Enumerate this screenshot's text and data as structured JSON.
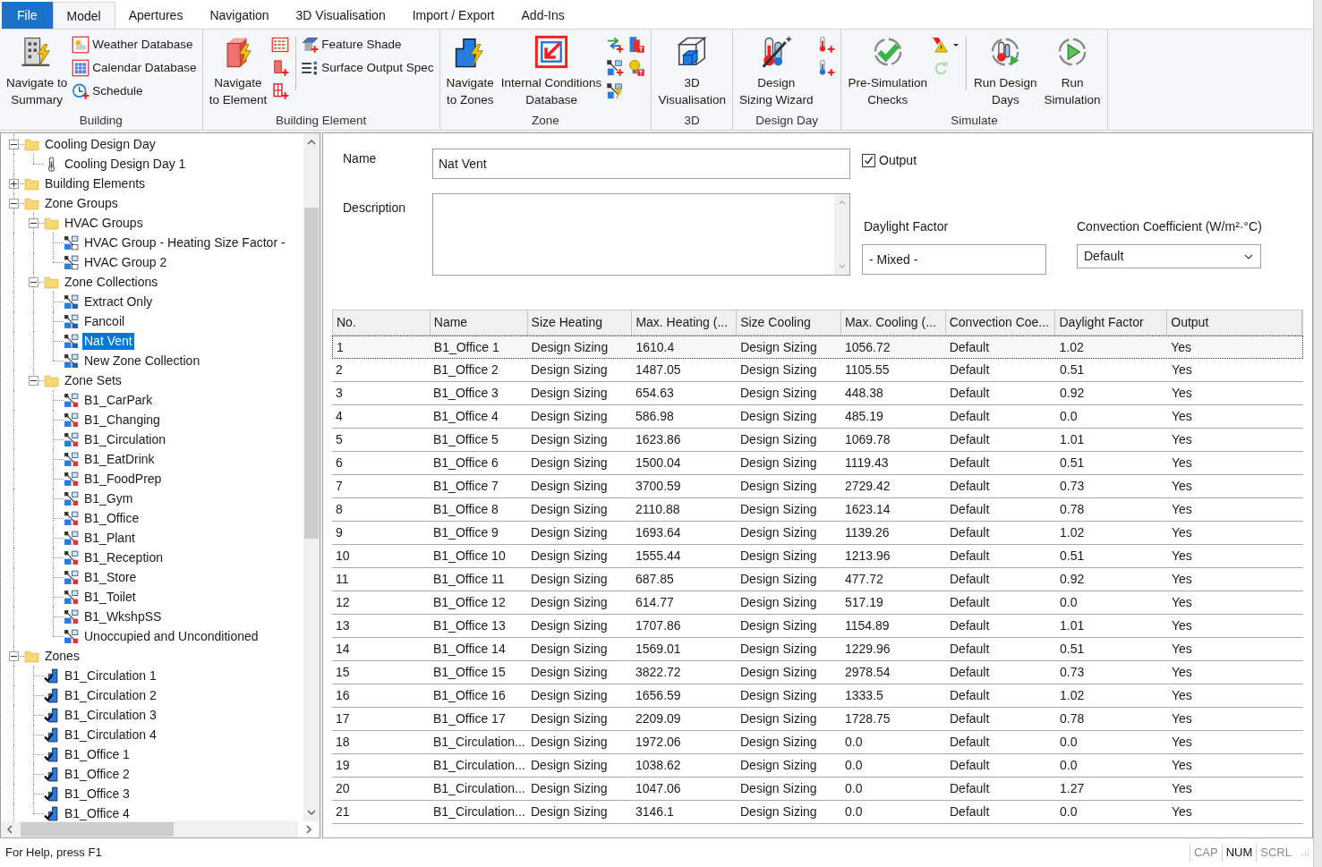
{
  "tabs": [
    {
      "label": "File",
      "kind": "file",
      "selected": false
    },
    {
      "label": "Model",
      "kind": "tab",
      "selected": true
    },
    {
      "label": "Apertures",
      "kind": "tab",
      "selected": false
    },
    {
      "label": "Navigation",
      "kind": "tab",
      "selected": false
    },
    {
      "label": "3D Visualisation",
      "kind": "tab",
      "selected": false
    },
    {
      "label": "Import / Export",
      "kind": "tab",
      "selected": false
    },
    {
      "label": "Add-Ins",
      "kind": "tab",
      "selected": false
    }
  ],
  "ribbon": {
    "groups": [
      {
        "label": "Building",
        "columns": [
          {
            "kind": "large",
            "label": "Navigate to\nSummary"
          },
          {
            "kind": "stack",
            "items": [
              {
                "kind": "small",
                "label": "Weather Database"
              },
              {
                "kind": "small",
                "label": "Calendar Database"
              },
              {
                "kind": "small",
                "label": "Schedule"
              }
            ]
          }
        ]
      },
      {
        "label": "Building Element",
        "columns": [
          {
            "kind": "large",
            "label": "Navigate\nto Element"
          },
          {
            "kind": "stack",
            "items": [
              {
                "kind": "icon"
              },
              {
                "kind": "icon"
              },
              {
                "kind": "icon"
              }
            ]
          },
          {
            "kind": "stack",
            "divider_before": true,
            "items": [
              {
                "kind": "small",
                "label": "Feature Shade"
              },
              {
                "kind": "small",
                "label": "Surface Output Spec"
              }
            ]
          }
        ]
      },
      {
        "label": "Zone",
        "columns": [
          {
            "kind": "large",
            "label": "Navigate\nto Zones"
          },
          {
            "kind": "large",
            "label": "Internal Conditions\nDatabase"
          },
          {
            "kind": "stack",
            "items": [
              {
                "kind": "icon"
              },
              {
                "kind": "icon"
              },
              {
                "kind": "icon"
              }
            ]
          },
          {
            "kind": "stack",
            "items": [
              {
                "kind": "icon"
              },
              {
                "kind": "icon"
              }
            ]
          }
        ]
      },
      {
        "label": "3D",
        "columns": [
          {
            "kind": "large",
            "label": "3D\nVisualisation"
          }
        ]
      },
      {
        "label": "Design Day",
        "columns": [
          {
            "kind": "large",
            "label": "Design\nSizing Wizard"
          },
          {
            "kind": "stack",
            "items": [
              {
                "kind": "icon"
              },
              {
                "kind": "icon"
              }
            ]
          }
        ]
      },
      {
        "label": "Simulate",
        "columns": [
          {
            "kind": "large",
            "label": "Pre-Simulation\nChecks",
            "disabled": false
          },
          {
            "kind": "stack",
            "items": [
              {
                "kind": "split",
                "disabled": false
              },
              {
                "kind": "icon",
                "disabled": true
              }
            ]
          },
          {
            "kind": "large",
            "divider_before": true,
            "label": "Run Design\nDays",
            "disabled": false
          },
          {
            "kind": "large",
            "label": "Run\nSimulation",
            "disabled": false
          }
        ]
      }
    ]
  },
  "tree": [
    {
      "label": "Cooling Design Day",
      "kind": "folder",
      "expanded": true,
      "selected": false,
      "children": [
        {
          "label": "Cooling Design Day 1",
          "kind": "design-day",
          "selected": false
        }
      ]
    },
    {
      "label": "Building Elements",
      "kind": "folder",
      "expanded": false,
      "selected": false
    },
    {
      "label": "Zone Groups",
      "kind": "folder",
      "expanded": true,
      "selected": false,
      "children": [
        {
          "label": "HVAC Groups",
          "kind": "folder",
          "expanded": true,
          "selected": false,
          "children": [
            {
              "label": "HVAC Group - Heating Size Factor -",
              "kind": "hvac",
              "selected": false
            },
            {
              "label": "HVAC Group 2",
              "kind": "hvac",
              "selected": false
            }
          ]
        },
        {
          "label": "Zone Collections",
          "kind": "folder",
          "expanded": true,
          "selected": false,
          "children": [
            {
              "label": "Extract Only",
              "kind": "collection",
              "selected": false
            },
            {
              "label": "Fancoil",
              "kind": "collection",
              "selected": false
            },
            {
              "label": "Nat Vent",
              "kind": "collection",
              "selected": true
            },
            {
              "label": "New Zone Collection",
              "kind": "collection",
              "selected": false
            }
          ]
        },
        {
          "label": "Zone Sets",
          "kind": "folder",
          "expanded": true,
          "selected": false,
          "children": [
            {
              "label": "B1_CarPark",
              "kind": "set",
              "selected": false
            },
            {
              "label": "B1_Changing",
              "kind": "set",
              "selected": false
            },
            {
              "label": "B1_Circulation",
              "kind": "set",
              "selected": false
            },
            {
              "label": "B1_EatDrink",
              "kind": "set",
              "selected": false
            },
            {
              "label": "B1_FoodPrep",
              "kind": "set",
              "selected": false
            },
            {
              "label": "B1_Gym",
              "kind": "set",
              "selected": false
            },
            {
              "label": "B1_Office",
              "kind": "set",
              "selected": false
            },
            {
              "label": "B1_Plant",
              "kind": "set",
              "selected": false
            },
            {
              "label": "B1_Reception",
              "kind": "set",
              "selected": false
            },
            {
              "label": "B1_Store",
              "kind": "set",
              "selected": false
            },
            {
              "label": "B1_Toilet",
              "kind": "set",
              "selected": false
            },
            {
              "label": "B1_WkshpSS",
              "kind": "set",
              "selected": false
            },
            {
              "label": "Unoccupied and Unconditioned",
              "kind": "set",
              "selected": false
            }
          ]
        }
      ]
    },
    {
      "label": "Zones",
      "kind": "folder",
      "expanded": true,
      "selected": false,
      "children": [
        {
          "label": "B1_Circulation 1",
          "kind": "zone",
          "selected": false
        },
        {
          "label": "B1_Circulation 2",
          "kind": "zone",
          "selected": false
        },
        {
          "label": "B1_Circulation 3",
          "kind": "zone",
          "selected": false
        },
        {
          "label": "B1_Circulation 4",
          "kind": "zone",
          "selected": false
        },
        {
          "label": "B1_Office 1",
          "kind": "zone",
          "selected": false
        },
        {
          "label": "B1_Office 2",
          "kind": "zone",
          "selected": false
        },
        {
          "label": "B1_Office 3",
          "kind": "zone",
          "selected": false
        },
        {
          "label": "B1_Office 4",
          "kind": "zone",
          "selected": false
        }
      ]
    }
  ],
  "form": {
    "name": {
      "label": "Name",
      "value": "Nat Vent"
    },
    "output": {
      "label": "Output",
      "checked": true
    },
    "description": {
      "label": "Description"
    },
    "daylight_factor": {
      "label": "Daylight Factor",
      "value": "- Mixed -"
    },
    "convection_coefficient": {
      "label": "Convection Coefficient (W/m²·°C)",
      "value": "Default"
    }
  },
  "table": {
    "columns": [
      "No.",
      "Name",
      "Size Heating",
      "Max. Heating (...",
      "Size Cooling",
      "Max. Cooling (...",
      "Convection Coe...",
      "Daylight Factor",
      "Output"
    ],
    "rows": [
      {
        "selected": true,
        "cells": [
          "1",
          "B1_Office 1",
          "Design Sizing",
          "1610.4",
          "Design Sizing",
          "1056.72",
          "Default",
          "1.02",
          "Yes"
        ]
      },
      {
        "selected": false,
        "cells": [
          "2",
          "B1_Office 2",
          "Design Sizing",
          "1487.05",
          "Design Sizing",
          "1105.55",
          "Default",
          "0.51",
          "Yes"
        ]
      },
      {
        "selected": false,
        "cells": [
          "3",
          "B1_Office 3",
          "Design Sizing",
          "654.63",
          "Design Sizing",
          "448.38",
          "Default",
          "0.92",
          "Yes"
        ]
      },
      {
        "selected": false,
        "cells": [
          "4",
          "B1_Office 4",
          "Design Sizing",
          "586.98",
          "Design Sizing",
          "485.19",
          "Default",
          "0.0",
          "Yes"
        ]
      },
      {
        "selected": false,
        "cells": [
          "5",
          "B1_Office 5",
          "Design Sizing",
          "1623.86",
          "Design Sizing",
          "1069.78",
          "Default",
          "1.01",
          "Yes"
        ]
      },
      {
        "selected": false,
        "cells": [
          "6",
          "B1_Office 6",
          "Design Sizing",
          "1500.04",
          "Design Sizing",
          "1119.43",
          "Default",
          "0.51",
          "Yes"
        ]
      },
      {
        "selected": false,
        "cells": [
          "7",
          "B1_Office 7",
          "Design Sizing",
          "3700.59",
          "Design Sizing",
          "2729.42",
          "Default",
          "0.73",
          "Yes"
        ]
      },
      {
        "selected": false,
        "cells": [
          "8",
          "B1_Office 8",
          "Design Sizing",
          "2110.88",
          "Design Sizing",
          "1623.14",
          "Default",
          "0.78",
          "Yes"
        ]
      },
      {
        "selected": false,
        "cells": [
          "9",
          "B1_Office 9",
          "Design Sizing",
          "1693.64",
          "Design Sizing",
          "1139.26",
          "Default",
          "1.02",
          "Yes"
        ]
      },
      {
        "selected": false,
        "cells": [
          "10",
          "B1_Office 10",
          "Design Sizing",
          "1555.44",
          "Design Sizing",
          "1213.96",
          "Default",
          "0.51",
          "Yes"
        ]
      },
      {
        "selected": false,
        "cells": [
          "11",
          "B1_Office 11",
          "Design Sizing",
          "687.85",
          "Design Sizing",
          "477.72",
          "Default",
          "0.92",
          "Yes"
        ]
      },
      {
        "selected": false,
        "cells": [
          "12",
          "B1_Office 12",
          "Design Sizing",
          "614.77",
          "Design Sizing",
          "517.19",
          "Default",
          "0.0",
          "Yes"
        ]
      },
      {
        "selected": false,
        "cells": [
          "13",
          "B1_Office 13",
          "Design Sizing",
          "1707.86",
          "Design Sizing",
          "1154.89",
          "Default",
          "1.01",
          "Yes"
        ]
      },
      {
        "selected": false,
        "cells": [
          "14",
          "B1_Office 14",
          "Design Sizing",
          "1569.01",
          "Design Sizing",
          "1229.96",
          "Default",
          "0.51",
          "Yes"
        ]
      },
      {
        "selected": false,
        "cells": [
          "15",
          "B1_Office 15",
          "Design Sizing",
          "3822.72",
          "Design Sizing",
          "2978.54",
          "Default",
          "0.73",
          "Yes"
        ]
      },
      {
        "selected": false,
        "cells": [
          "16",
          "B1_Office 16",
          "Design Sizing",
          "1656.59",
          "Design Sizing",
          "1333.5",
          "Default",
          "1.02",
          "Yes"
        ]
      },
      {
        "selected": false,
        "cells": [
          "17",
          "B1_Office 17",
          "Design Sizing",
          "2209.09",
          "Design Sizing",
          "1728.75",
          "Default",
          "0.78",
          "Yes"
        ]
      },
      {
        "selected": false,
        "cells": [
          "18",
          "B1_Circulation...",
          "Design Sizing",
          "1972.06",
          "Design Sizing",
          "0.0",
          "Default",
          "0.0",
          "Yes"
        ]
      },
      {
        "selected": false,
        "cells": [
          "19",
          "B1_Circulation...",
          "Design Sizing",
          "1038.62",
          "Design Sizing",
          "0.0",
          "Default",
          "0.0",
          "Yes"
        ]
      },
      {
        "selected": false,
        "cells": [
          "20",
          "B1_Circulation...",
          "Design Sizing",
          "1047.06",
          "Design Sizing",
          "0.0",
          "Default",
          "1.27",
          "Yes"
        ]
      },
      {
        "selected": false,
        "cells": [
          "21",
          "B1_Circulation...",
          "Design Sizing",
          "3146.1",
          "Design Sizing",
          "0.0",
          "Default",
          "0.0",
          "Yes"
        ]
      }
    ]
  },
  "status_bar": {
    "text": "For Help, press F1",
    "indicators": [
      {
        "label": "CAP",
        "on": false
      },
      {
        "label": "NUM",
        "on": true
      },
      {
        "label": "SCRL",
        "on": false
      }
    ]
  }
}
